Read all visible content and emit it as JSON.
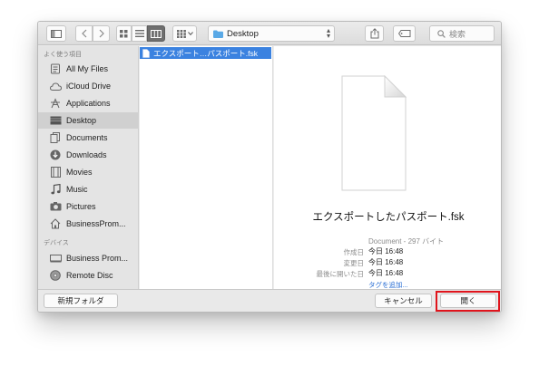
{
  "toolbar": {
    "location": "Desktop",
    "search_placeholder": "検索"
  },
  "sidebar": {
    "favorites_heading": "よく使う項目",
    "devices_heading": "デバイス",
    "favorites": [
      {
        "label": "All My Files",
        "icon": "all-files-icon"
      },
      {
        "label": "iCloud Drive",
        "icon": "cloud-icon"
      },
      {
        "label": "Applications",
        "icon": "applications-icon"
      },
      {
        "label": "Desktop",
        "icon": "desktop-icon",
        "selected": true
      },
      {
        "label": "Documents",
        "icon": "documents-icon"
      },
      {
        "label": "Downloads",
        "icon": "downloads-icon"
      },
      {
        "label": "Movies",
        "icon": "movies-icon"
      },
      {
        "label": "Music",
        "icon": "music-icon"
      },
      {
        "label": "Pictures",
        "icon": "pictures-icon"
      },
      {
        "label": "BusinessProm...",
        "icon": "home-icon"
      }
    ],
    "devices": [
      {
        "label": "Business Prom...",
        "icon": "computer-icon"
      },
      {
        "label": "Remote Disc",
        "icon": "disc-icon"
      }
    ]
  },
  "files": [
    {
      "name": "エクスポート…パスポート.fsk",
      "selected": true
    }
  ],
  "preview": {
    "title": "エクスポートしたパスポート.fsk",
    "kind": "Document - 297 バイト",
    "created_label": "作成日",
    "created_value": "今日 16:48",
    "modified_label": "変更日",
    "modified_value": "今日 16:48",
    "opened_label": "最後に開いた日",
    "opened_value": "今日 16:48",
    "add_tag": "タグを追加..."
  },
  "buttons": {
    "new_folder": "新規フォルダ",
    "cancel": "キャンセル",
    "open": "開く"
  },
  "colors": {
    "selection": "#3b82e0",
    "highlight_box": "#e0141c"
  }
}
